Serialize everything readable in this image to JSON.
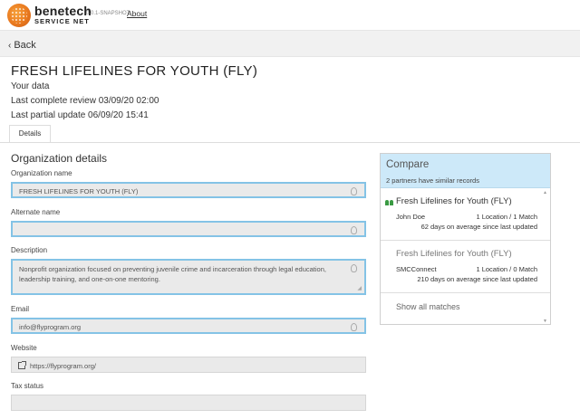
{
  "brand": {
    "name": "benetech",
    "sub": "SERVICE NET",
    "version": "0.0.1-SNAPSHOT",
    "about": "About"
  },
  "nav": {
    "back_icon": "‹",
    "back": "Back"
  },
  "record": {
    "title": "FRESH LIFELINES FOR YOUTH (FLY)",
    "subtitle": "Your data",
    "last_complete": "Last complete review 03/09/20 02:00",
    "last_partial": "Last partial update 06/09/20 15:41",
    "tab": "Details"
  },
  "org": {
    "section": "Organization details",
    "fields": {
      "name": {
        "label": "Organization name",
        "value": "FRESH LIFELINES FOR YOUTH (FLY)"
      },
      "alt": {
        "label": "Alternate name",
        "value": ""
      },
      "desc": {
        "label": "Description",
        "value": "Nonprofit organization focused on preventing juvenile crime and incarceration through legal education, leadership training, and one-on-one mentoring."
      },
      "email": {
        "label": "Email",
        "value": "info@flyprogram.org"
      },
      "website": {
        "label": "Website",
        "value": "https://flyprogram.org/"
      },
      "tax": {
        "label": "Tax status",
        "value": ""
      }
    }
  },
  "compare": {
    "title": "Compare",
    "subtitle": "2 partners have similar records",
    "items": [
      {
        "name": "Fresh Lifelines for Youth (FLY)",
        "owner": "John Doe",
        "matches": "1 Location / 1 Match",
        "updated": "62 days on average since last updated"
      },
      {
        "name": "Fresh Lifelines for Youth (FLY)",
        "owner": "SMCConnect",
        "matches": "1 Location / 0 Match",
        "updated": "210 days on average since last updated"
      }
    ],
    "show_all": "Show all matches"
  },
  "icons": {
    "logo": "benetech-logo-icon",
    "back": "chevron-left-icon",
    "people": "people-icon",
    "bulb": "lightbulb-icon",
    "link": "external-link-icon"
  },
  "colors": {
    "accent": "#84c3e6",
    "compare_header": "#cde9f9",
    "people": "#3a9a42"
  }
}
